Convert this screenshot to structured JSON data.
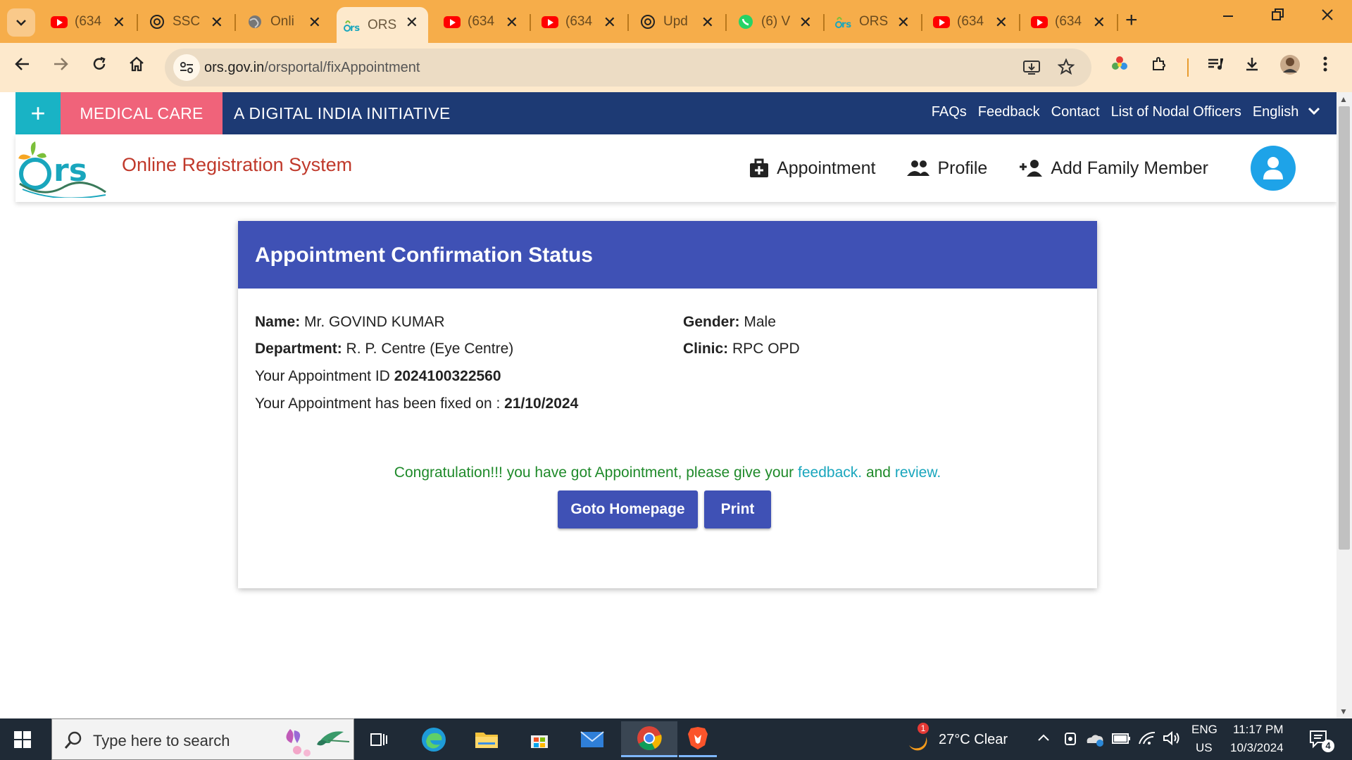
{
  "browser": {
    "tabs": [
      {
        "label": "(634",
        "icon": "youtube-icon"
      },
      {
        "label": "SSC",
        "icon": "chatgpt-icon"
      },
      {
        "label": "Onli",
        "icon": "globe-icon"
      },
      {
        "label": "ORS",
        "icon": "ors-icon",
        "active": true
      },
      {
        "label": "(634",
        "icon": "youtube-icon"
      },
      {
        "label": "(634",
        "icon": "youtube-icon"
      },
      {
        "label": "Upd",
        "icon": "chatgpt-icon"
      },
      {
        "label": "(6) V",
        "icon": "whatsapp-icon"
      },
      {
        "label": "ORS",
        "icon": "ors-icon"
      },
      {
        "label": "(634",
        "icon": "youtube-icon"
      },
      {
        "label": "(634",
        "icon": "youtube-icon"
      }
    ],
    "tab_close": "✕",
    "new_tab": "+",
    "url_host": "ors.gov.in",
    "url_path": "/orsportal/fixAppointment"
  },
  "site": {
    "topbar": {
      "plus": "+",
      "medical_care": "MEDICAL CARE",
      "initiative": "A DIGITAL INDIA INITIATIVE",
      "links": {
        "faqs": "FAQs",
        "feedback": "Feedback",
        "contact": "Contact",
        "nodal": "List of Nodal Officers",
        "language": "English"
      }
    },
    "header": {
      "brand": "Online Registration System",
      "nav": {
        "appointment": "Appointment",
        "profile": "Profile",
        "add_family": "Add Family Member"
      }
    }
  },
  "card": {
    "title": "Appointment Confirmation Status",
    "name_label": "Name:",
    "name_value": "Mr. GOVIND KUMAR",
    "gender_label": "Gender:",
    "gender_value": "Male",
    "dept_label": "Department:",
    "dept_value": "R. P. Centre (Eye Centre)",
    "clinic_label": "Clinic:",
    "clinic_value": "RPC OPD",
    "appt_id_label": "Your Appointment ID",
    "appt_id_value": "2024100322560",
    "fixed_label": "Your Appointment has been fixed on :",
    "fixed_value": "21/10/2024",
    "congrats_text": "Congratulation!!! you have got Appointment, please give your",
    "feedback_link": "feedback.",
    "and_text": "and",
    "review_link": "review.",
    "goto_button": "Goto Homepage",
    "print_button": "Print"
  },
  "taskbar": {
    "search_placeholder": "Type here to search",
    "weather": "27°C  Clear",
    "weather_badge": "1",
    "lang_top": "ENG",
    "lang_bottom": "US",
    "time": "11:17 PM",
    "date": "10/3/2024",
    "notifications": "4"
  },
  "colors": {
    "accent": "#3f51b5",
    "site_bar": "#1d3a74",
    "teal": "#19b3c5",
    "pink": "#f0637a",
    "brand_red": "#c0392b",
    "success": "#1f8a2a"
  }
}
